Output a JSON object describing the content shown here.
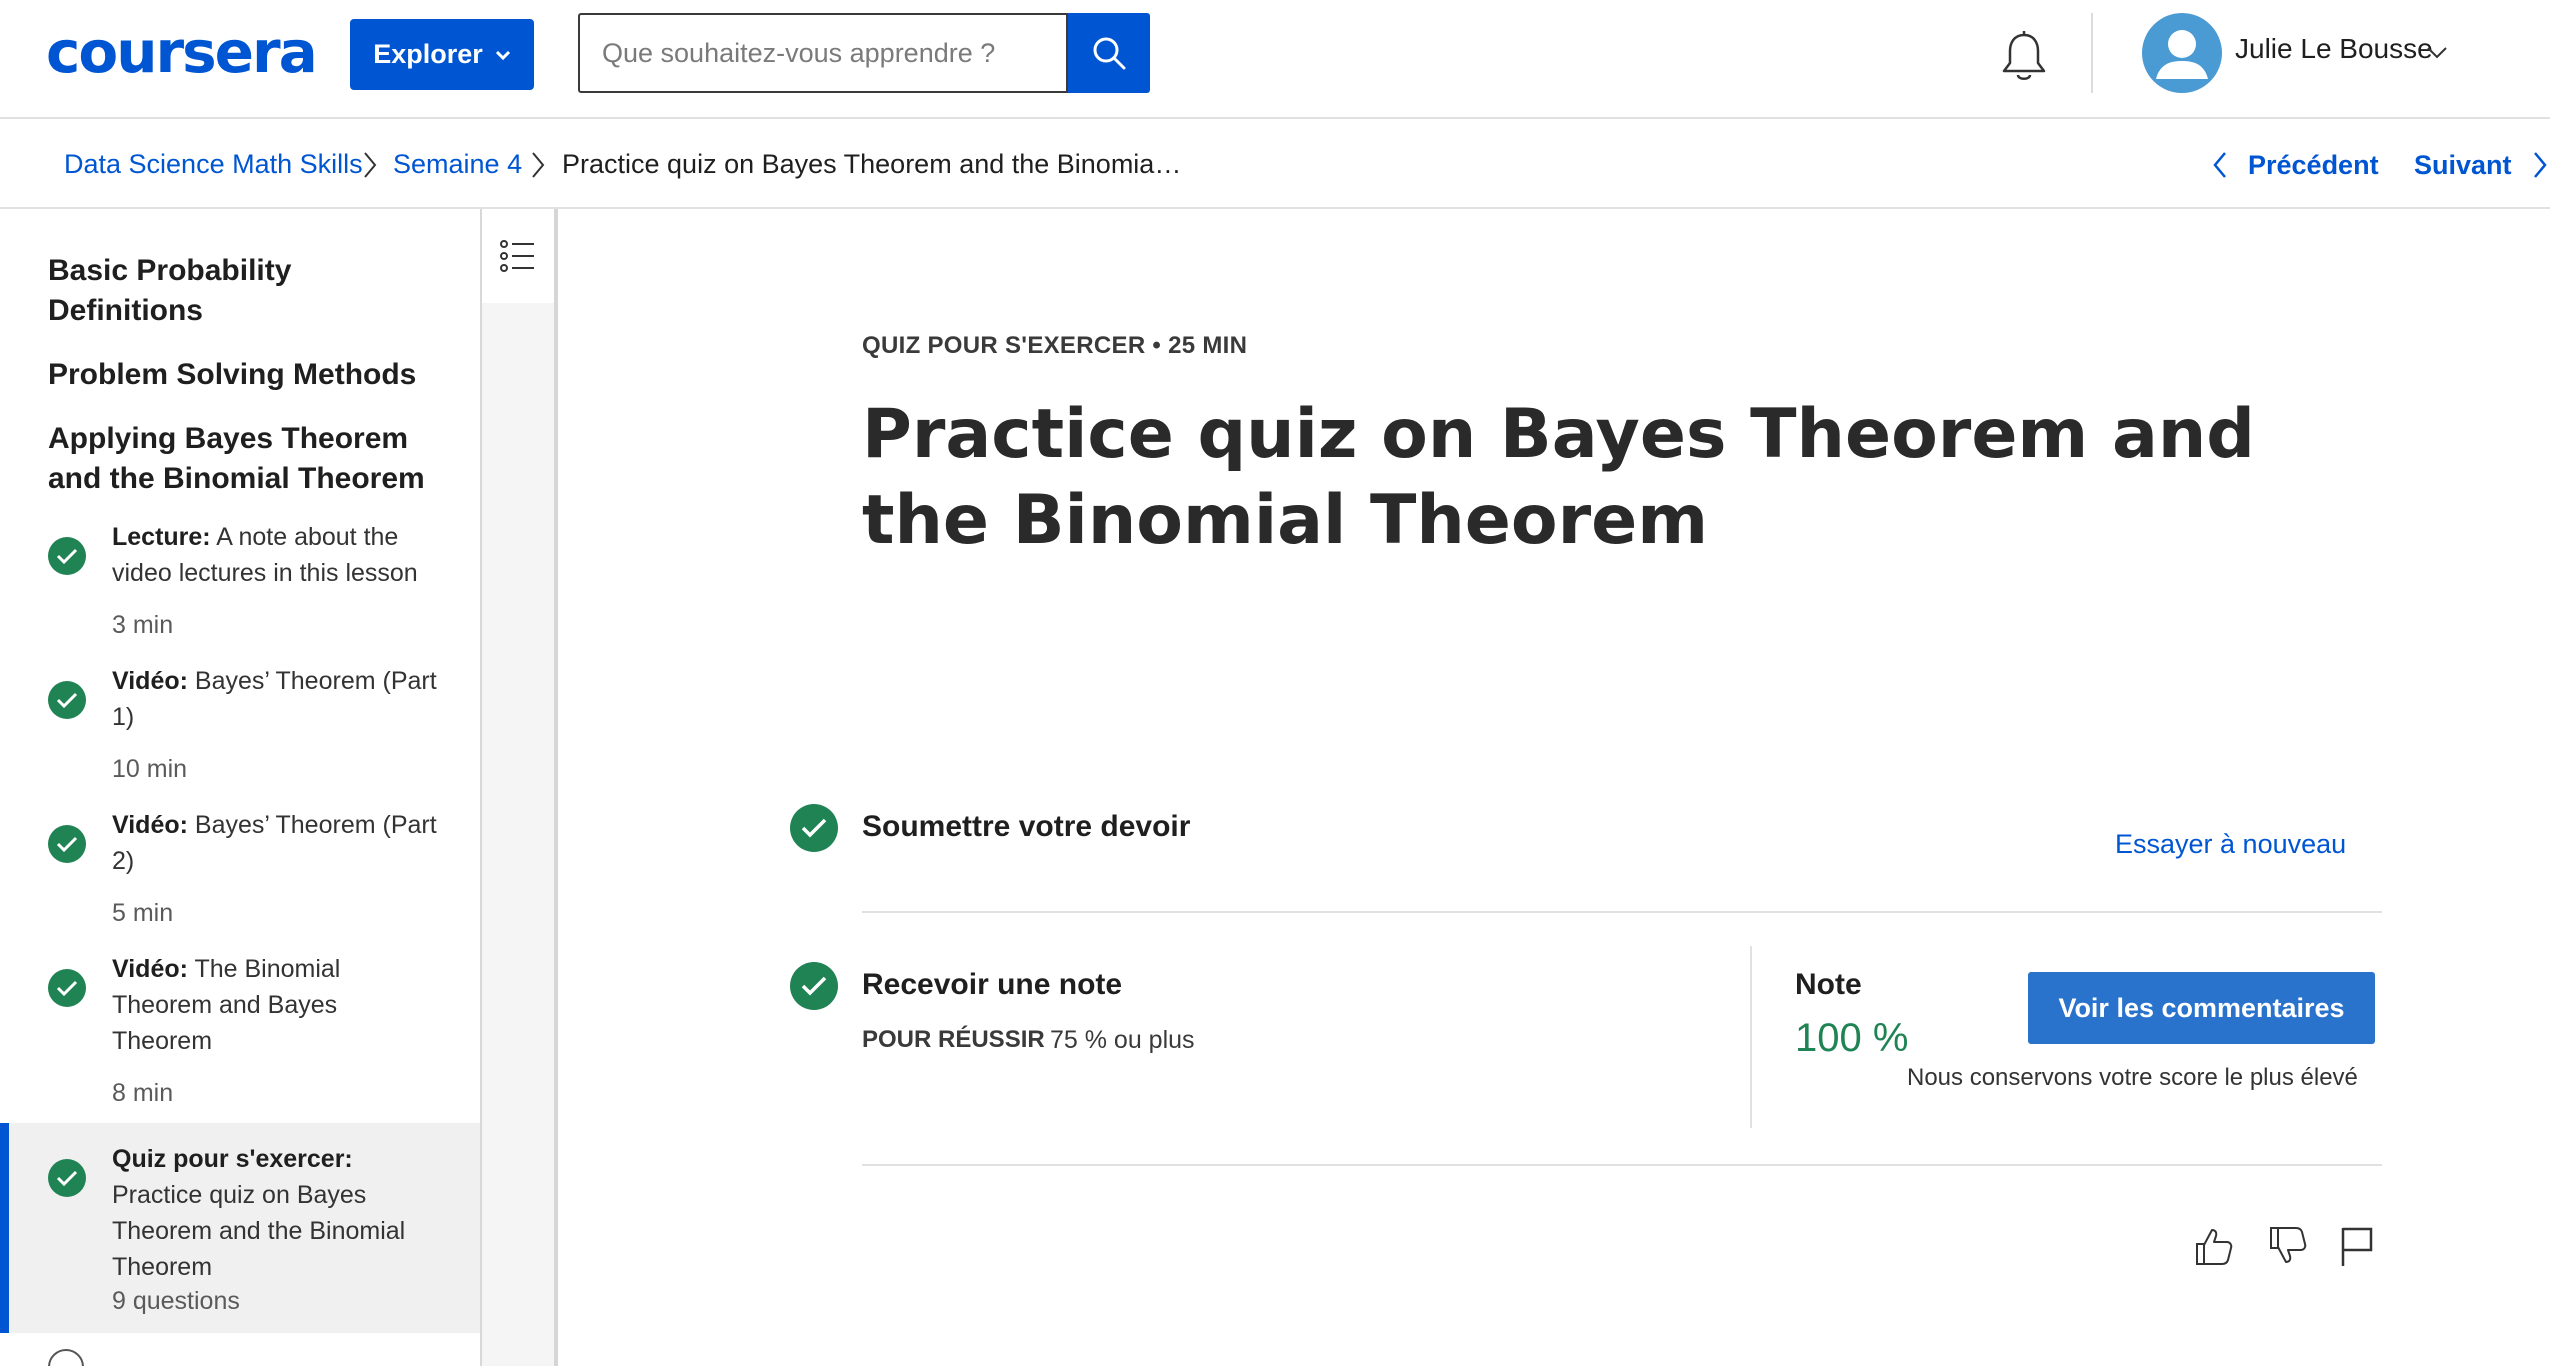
{
  "header": {
    "logo_text": "coursera",
    "explore_label": "Explorer",
    "search_placeholder": "Que souhaitez-vous apprendre ?",
    "user_name": "Julie Le Bousse"
  },
  "breadcrumb": {
    "items": [
      "Data Science Math Skills",
      "Semaine 4",
      "Practice quiz on Bayes Theorem and the Binomia…"
    ],
    "prev_label": "Précédent",
    "next_label": "Suivant"
  },
  "sidebar": {
    "lessons": [
      "Basic Probability Definitions",
      "Problem Solving Methods",
      "Applying Bayes Theorem and the Binomial Theorem"
    ],
    "items": [
      {
        "type": "Lecture:",
        "title": "A note about the video lectures in this lesson",
        "meta": "3 min",
        "completed": true
      },
      {
        "type": "Vidéo:",
        "title": "Bayes’ Theorem (Part 1)",
        "meta": "10 min",
        "completed": true
      },
      {
        "type": "Vidéo:",
        "title": "Bayes’ Theorem (Part 2)",
        "meta": "5 min",
        "completed": true
      },
      {
        "type": "Vidéo:",
        "title": "The Binomial Theorem and Bayes Theorem",
        "meta": "8 min",
        "completed": true
      },
      {
        "type": "Quiz pour s'exercer:",
        "title": "Practice quiz on Bayes Theorem and the Binomial Theorem",
        "meta": "9 questions",
        "completed": true,
        "active": true
      }
    ]
  },
  "main": {
    "kicker": "QUIZ POUR S'EXERCER • 25 MIN",
    "title": "Practice quiz on Bayes Theorem and the Binomial Theorem",
    "submit_step": {
      "title": "Soumettre votre devoir",
      "retry_label": "Essayer à nouveau"
    },
    "grade_step": {
      "title": "Recevoir une note",
      "pass_label": "POUR RÉUSSIR",
      "pass_value": "75 % ou plus",
      "grade_label": "Note",
      "grade_value": "100 %",
      "feedback_button": "Voir les commentaires",
      "highest_note": "Nous conservons votre score le plus élevé"
    }
  },
  "colors": {
    "brand": "#0056d2",
    "success": "#1f8354",
    "button": "#2a73cc"
  },
  "icons": [
    "search-icon",
    "bell-icon",
    "chevron-down-icon",
    "chevron-left-icon",
    "chevron-right-icon",
    "check-icon",
    "list-icon",
    "thumbs-up-icon",
    "thumbs-down-icon",
    "flag-icon"
  ]
}
